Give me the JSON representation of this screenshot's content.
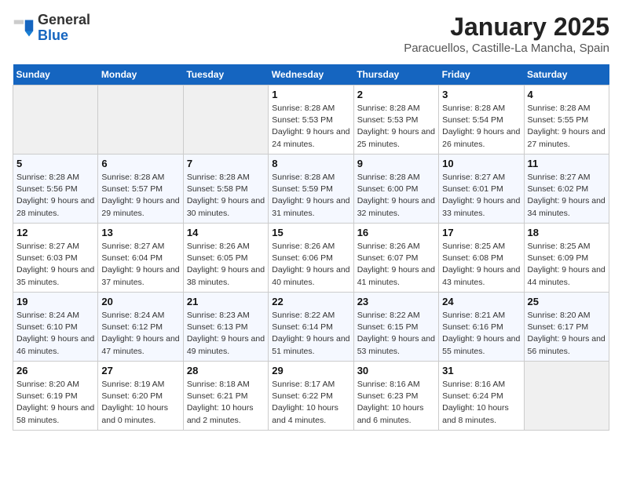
{
  "header": {
    "logo_line1": "General",
    "logo_line2": "Blue",
    "month_year": "January 2025",
    "location": "Paracuellos, Castille-La Mancha, Spain"
  },
  "weekdays": [
    "Sunday",
    "Monday",
    "Tuesday",
    "Wednesday",
    "Thursday",
    "Friday",
    "Saturday"
  ],
  "weeks": [
    [
      {
        "day": "",
        "detail": ""
      },
      {
        "day": "",
        "detail": ""
      },
      {
        "day": "",
        "detail": ""
      },
      {
        "day": "1",
        "detail": "Sunrise: 8:28 AM\nSunset: 5:53 PM\nDaylight: 9 hours\nand 24 minutes."
      },
      {
        "day": "2",
        "detail": "Sunrise: 8:28 AM\nSunset: 5:53 PM\nDaylight: 9 hours\nand 25 minutes."
      },
      {
        "day": "3",
        "detail": "Sunrise: 8:28 AM\nSunset: 5:54 PM\nDaylight: 9 hours\nand 26 minutes."
      },
      {
        "day": "4",
        "detail": "Sunrise: 8:28 AM\nSunset: 5:55 PM\nDaylight: 9 hours\nand 27 minutes."
      }
    ],
    [
      {
        "day": "5",
        "detail": "Sunrise: 8:28 AM\nSunset: 5:56 PM\nDaylight: 9 hours\nand 28 minutes."
      },
      {
        "day": "6",
        "detail": "Sunrise: 8:28 AM\nSunset: 5:57 PM\nDaylight: 9 hours\nand 29 minutes."
      },
      {
        "day": "7",
        "detail": "Sunrise: 8:28 AM\nSunset: 5:58 PM\nDaylight: 9 hours\nand 30 minutes."
      },
      {
        "day": "8",
        "detail": "Sunrise: 8:28 AM\nSunset: 5:59 PM\nDaylight: 9 hours\nand 31 minutes."
      },
      {
        "day": "9",
        "detail": "Sunrise: 8:28 AM\nSunset: 6:00 PM\nDaylight: 9 hours\nand 32 minutes."
      },
      {
        "day": "10",
        "detail": "Sunrise: 8:27 AM\nSunset: 6:01 PM\nDaylight: 9 hours\nand 33 minutes."
      },
      {
        "day": "11",
        "detail": "Sunrise: 8:27 AM\nSunset: 6:02 PM\nDaylight: 9 hours\nand 34 minutes."
      }
    ],
    [
      {
        "day": "12",
        "detail": "Sunrise: 8:27 AM\nSunset: 6:03 PM\nDaylight: 9 hours\nand 35 minutes."
      },
      {
        "day": "13",
        "detail": "Sunrise: 8:27 AM\nSunset: 6:04 PM\nDaylight: 9 hours\nand 37 minutes."
      },
      {
        "day": "14",
        "detail": "Sunrise: 8:26 AM\nSunset: 6:05 PM\nDaylight: 9 hours\nand 38 minutes."
      },
      {
        "day": "15",
        "detail": "Sunrise: 8:26 AM\nSunset: 6:06 PM\nDaylight: 9 hours\nand 40 minutes."
      },
      {
        "day": "16",
        "detail": "Sunrise: 8:26 AM\nSunset: 6:07 PM\nDaylight: 9 hours\nand 41 minutes."
      },
      {
        "day": "17",
        "detail": "Sunrise: 8:25 AM\nSunset: 6:08 PM\nDaylight: 9 hours\nand 43 minutes."
      },
      {
        "day": "18",
        "detail": "Sunrise: 8:25 AM\nSunset: 6:09 PM\nDaylight: 9 hours\nand 44 minutes."
      }
    ],
    [
      {
        "day": "19",
        "detail": "Sunrise: 8:24 AM\nSunset: 6:10 PM\nDaylight: 9 hours\nand 46 minutes."
      },
      {
        "day": "20",
        "detail": "Sunrise: 8:24 AM\nSunset: 6:12 PM\nDaylight: 9 hours\nand 47 minutes."
      },
      {
        "day": "21",
        "detail": "Sunrise: 8:23 AM\nSunset: 6:13 PM\nDaylight: 9 hours\nand 49 minutes."
      },
      {
        "day": "22",
        "detail": "Sunrise: 8:22 AM\nSunset: 6:14 PM\nDaylight: 9 hours\nand 51 minutes."
      },
      {
        "day": "23",
        "detail": "Sunrise: 8:22 AM\nSunset: 6:15 PM\nDaylight: 9 hours\nand 53 minutes."
      },
      {
        "day": "24",
        "detail": "Sunrise: 8:21 AM\nSunset: 6:16 PM\nDaylight: 9 hours\nand 55 minutes."
      },
      {
        "day": "25",
        "detail": "Sunrise: 8:20 AM\nSunset: 6:17 PM\nDaylight: 9 hours\nand 56 minutes."
      }
    ],
    [
      {
        "day": "26",
        "detail": "Sunrise: 8:20 AM\nSunset: 6:19 PM\nDaylight: 9 hours\nand 58 minutes."
      },
      {
        "day": "27",
        "detail": "Sunrise: 8:19 AM\nSunset: 6:20 PM\nDaylight: 10 hours\nand 0 minutes."
      },
      {
        "day": "28",
        "detail": "Sunrise: 8:18 AM\nSunset: 6:21 PM\nDaylight: 10 hours\nand 2 minutes."
      },
      {
        "day": "29",
        "detail": "Sunrise: 8:17 AM\nSunset: 6:22 PM\nDaylight: 10 hours\nand 4 minutes."
      },
      {
        "day": "30",
        "detail": "Sunrise: 8:16 AM\nSunset: 6:23 PM\nDaylight: 10 hours\nand 6 minutes."
      },
      {
        "day": "31",
        "detail": "Sunrise: 8:16 AM\nSunset: 6:24 PM\nDaylight: 10 hours\nand 8 minutes."
      },
      {
        "day": "",
        "detail": ""
      }
    ]
  ]
}
